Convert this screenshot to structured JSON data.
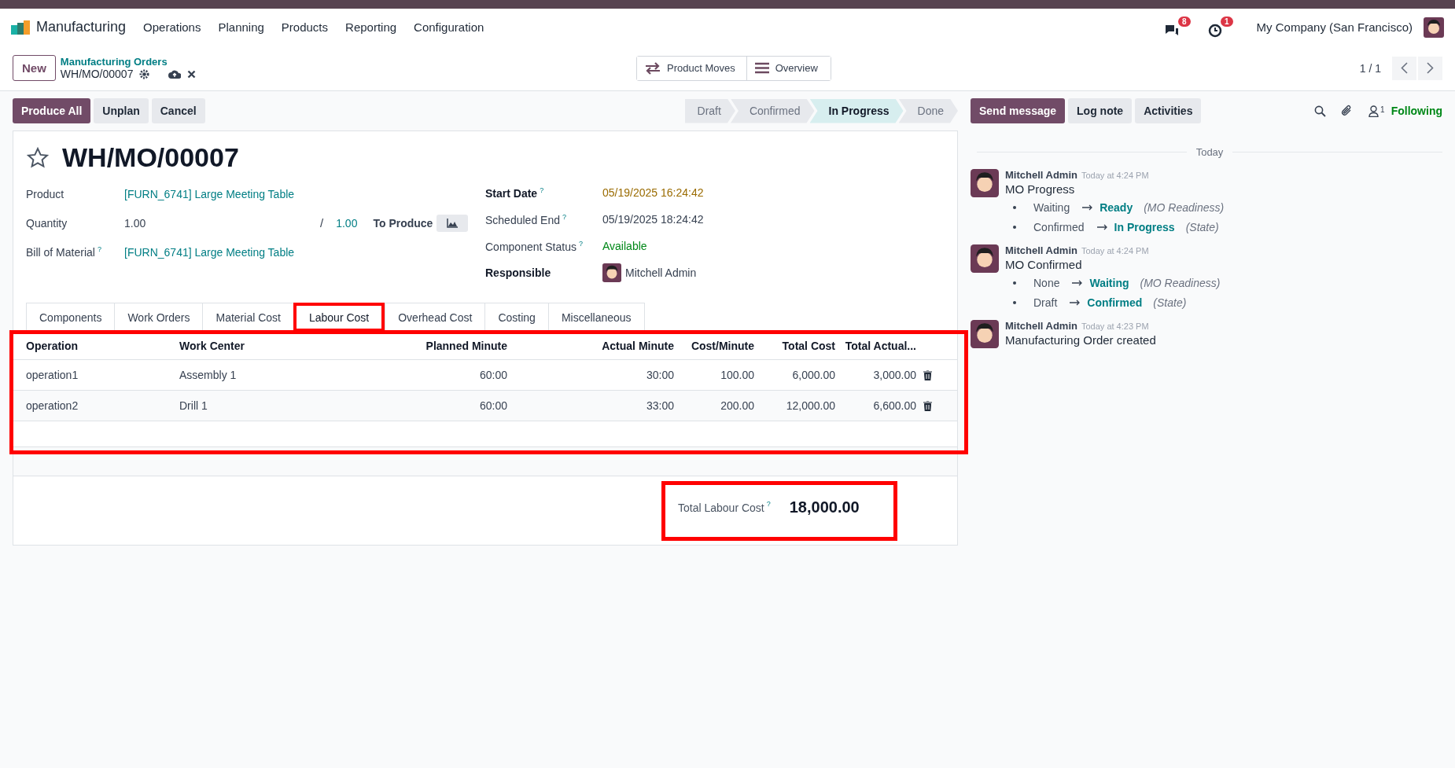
{
  "navbar": {
    "app": "Manufacturing",
    "menus": [
      "Operations",
      "Planning",
      "Products",
      "Reporting",
      "Configuration"
    ],
    "messages_badge": "8",
    "activities_badge": "1",
    "company": "My Company (San Francisco)"
  },
  "control_panel": {
    "new_button": "New",
    "breadcrumb": "Manufacturing Orders",
    "record": "WH/MO/00007",
    "smart_buttons": [
      {
        "label": "Product Moves",
        "kind": "moves"
      },
      {
        "label": "Overview",
        "kind": "overview"
      }
    ],
    "pager": "1 / 1"
  },
  "actions": [
    {
      "label": "Produce All",
      "kind": "primary"
    },
    {
      "label": "Unplan",
      "kind": "secondary"
    },
    {
      "label": "Cancel",
      "kind": "secondary"
    }
  ],
  "stages": [
    {
      "label": "Draft",
      "selected": false
    },
    {
      "label": "Confirmed",
      "selected": false
    },
    {
      "label": "In Progress",
      "selected": true
    },
    {
      "label": "Done",
      "selected": false
    }
  ],
  "chatter_buttons": [
    {
      "label": "Send message",
      "kind": "primary"
    },
    {
      "label": "Log note",
      "kind": "secondary"
    },
    {
      "label": "Activities",
      "kind": "secondary"
    }
  ],
  "followers_count": "1",
  "following": "Following",
  "form": {
    "title": "WH/MO/00007",
    "starred": false,
    "left_fields": [
      {
        "label": "Product",
        "value": "[FURN_6741] Large Meeting Table",
        "kind": "link"
      },
      {
        "label": "Quantity",
        "value": "1.00",
        "kind": "quantity",
        "separator": "/",
        "produced": "1.00",
        "unit_label": "To Produce"
      },
      {
        "label": "Bill of Material",
        "help": "?",
        "value": "[FURN_6741] Large Meeting Table",
        "kind": "link"
      }
    ],
    "right_fields": [
      {
        "label": "Start Date",
        "help": "?",
        "required": true,
        "value": "05/19/2025 16:24:42",
        "kind": "warning"
      },
      {
        "label": "Scheduled End",
        "help": "?",
        "required": false,
        "value": "05/19/2025 18:24:42",
        "kind": "text"
      },
      {
        "label": "Component Status",
        "help": "?",
        "required": false,
        "value": "Available",
        "kind": "success"
      },
      {
        "label": "Responsible",
        "required": true,
        "value": "Mitchell Admin",
        "kind": "user"
      }
    ],
    "tabs": [
      {
        "label": "Components",
        "selected": false,
        "highlighted": false
      },
      {
        "label": "Work Orders",
        "selected": false,
        "highlighted": false
      },
      {
        "label": "Material Cost",
        "selected": false,
        "highlighted": false
      },
      {
        "label": "Labour Cost",
        "selected": true,
        "highlighted": true
      },
      {
        "label": "Overhead Cost",
        "selected": false,
        "highlighted": false
      },
      {
        "label": "Costing",
        "selected": false,
        "highlighted": false
      },
      {
        "label": "Miscellaneous",
        "selected": false,
        "highlighted": false
      }
    ],
    "table": {
      "highlighted": true,
      "columns": [
        {
          "label": "Operation",
          "numeric": false
        },
        {
          "label": "Work Center",
          "numeric": false
        },
        {
          "label": "Planned Minute",
          "numeric": true
        },
        {
          "label": "Actual Minute",
          "numeric": true
        },
        {
          "label": "Cost/Minute",
          "numeric": true
        },
        {
          "label": "Total Cost",
          "numeric": true
        },
        {
          "label": "Total Actual...",
          "numeric": true
        }
      ],
      "rows": [
        [
          "operation1",
          "Assembly 1",
          "60:00",
          "30:00",
          "100.00",
          "6,000.00",
          "3,000.00"
        ],
        [
          "operation2",
          "Drill 1",
          "60:00",
          "33:00",
          "200.00",
          "12,000.00",
          "6,600.00"
        ]
      ]
    },
    "total": {
      "label": "Total Labour Cost",
      "help": "?",
      "value": "18,000.00",
      "highlighted": true
    }
  },
  "chatter": {
    "separator": "Today",
    "messages": [
      {
        "author": "Mitchell Admin",
        "time": "Today at 4:24 PM",
        "body": "MO Progress",
        "changes": [
          {
            "from": "Waiting",
            "to": "Ready",
            "field": "(MO Readiness)"
          },
          {
            "from": "Confirmed",
            "to": "In Progress",
            "field": "(State)"
          }
        ]
      },
      {
        "author": "Mitchell Admin",
        "time": "Today at 4:24 PM",
        "body": "MO Confirmed",
        "changes": [
          {
            "from": "None",
            "to": "Waiting",
            "field": "(MO Readiness)"
          },
          {
            "from": "Draft",
            "to": "Confirmed",
            "field": "(State)"
          }
        ]
      },
      {
        "author": "Mitchell Admin",
        "time": "Today at 4:23 PM",
        "body": "Manufacturing Order created"
      }
    ]
  }
}
